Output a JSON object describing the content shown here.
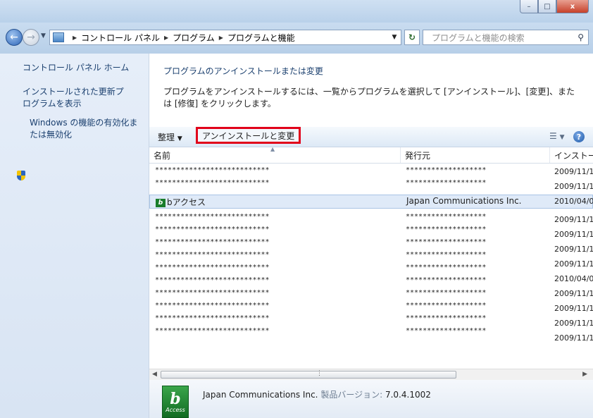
{
  "window": {
    "minimize_label": "–",
    "maximize_label": "□",
    "close_label": "x"
  },
  "address": {
    "breadcrumbs": [
      "コントロール パネル",
      "プログラム",
      "プログラムと機能"
    ],
    "search_placeholder": "プログラムと機能の検索"
  },
  "sidebar": {
    "items": [
      {
        "label": "コントロール パネル ホーム"
      },
      {
        "label": "インストールされた更新プログラムを表示"
      },
      {
        "label": "Windows の機能の有効化または無効化"
      }
    ]
  },
  "main": {
    "title": "プログラムのアンインストールまたは変更",
    "description": "プログラムをアンインストールするには、一覧からプログラムを選択して [アンインストール]、[変更]、または [修復] をクリックします。"
  },
  "toolbar": {
    "organize_label": "整理",
    "uninstall_label": "アンインストールと変更"
  },
  "columns": {
    "name": "名前",
    "publisher": "発行元",
    "installed": "インストー"
  },
  "rows": [
    {
      "name": "***************************",
      "publisher": "*******************"
    },
    {
      "name": "***************************",
      "publisher": "*******************"
    },
    {
      "name": "bアクセス",
      "publisher": "Japan Communications Inc."
    },
    {
      "name": "***************************",
      "publisher": "*******************"
    },
    {
      "name": "***************************",
      "publisher": "*******************"
    },
    {
      "name": "***************************",
      "publisher": "*******************"
    },
    {
      "name": "***************************",
      "publisher": "*******************"
    },
    {
      "name": "***************************",
      "publisher": "*******************"
    },
    {
      "name": "***************************",
      "publisher": "*******************"
    },
    {
      "name": "***************************",
      "publisher": "*******************"
    },
    {
      "name": "***************************",
      "publisher": "*******************"
    },
    {
      "name": "***************************",
      "publisher": "*******************"
    },
    {
      "name": "***************************",
      "publisher": "*******************"
    }
  ],
  "dates": [
    "2009/11/1",
    "2009/11/1",
    "2010/04/0",
    "2009/11/1",
    "2009/11/1",
    "2009/11/1",
    "2009/11/1",
    "2010/04/0",
    "2009/11/1",
    "2009/11/1",
    "2009/11/1",
    "2009/11/1"
  ],
  "details": {
    "publisher": "Japan Communications Inc.",
    "version_label": "製品バージョン:",
    "version": "7.0.4.1002",
    "icon_letter": "b",
    "icon_text": "Access"
  }
}
